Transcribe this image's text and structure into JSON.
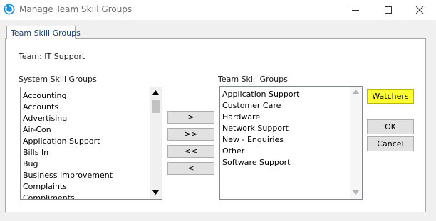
{
  "window": {
    "title": "Manage Team Skill Groups",
    "icon": "refresh-circle-icon",
    "controls": [
      "minimize-icon",
      "maximize-icon",
      "close-icon"
    ]
  },
  "tabs": [
    {
      "label": "Team Skill Groups",
      "active": true
    }
  ],
  "team_label": "Team: IT Support",
  "system_list": {
    "label": "System Skill Groups",
    "items": [
      "Accounting",
      "Accounts",
      "Advertising",
      "Air-Con",
      "Application Support",
      "Bills In",
      "Bug",
      "Business Improvement",
      "Complaints",
      "Compliments"
    ]
  },
  "team_list": {
    "label": "Team Skill Groups",
    "items": [
      "Application Support",
      "Customer Care",
      "Hardware",
      "Network Support",
      "New - Enquiries",
      "Other",
      "Software Support"
    ]
  },
  "move_buttons": {
    "add": ">",
    "add_all": ">>",
    "remove_all": "<<",
    "remove": "<"
  },
  "actions": {
    "watchers": "Watchers",
    "ok": "OK",
    "cancel": "Cancel"
  },
  "colors": {
    "watchers_highlight": "#ffff33",
    "tab_text": "#1a3d6b",
    "app_icon": "#1e8fd6"
  }
}
